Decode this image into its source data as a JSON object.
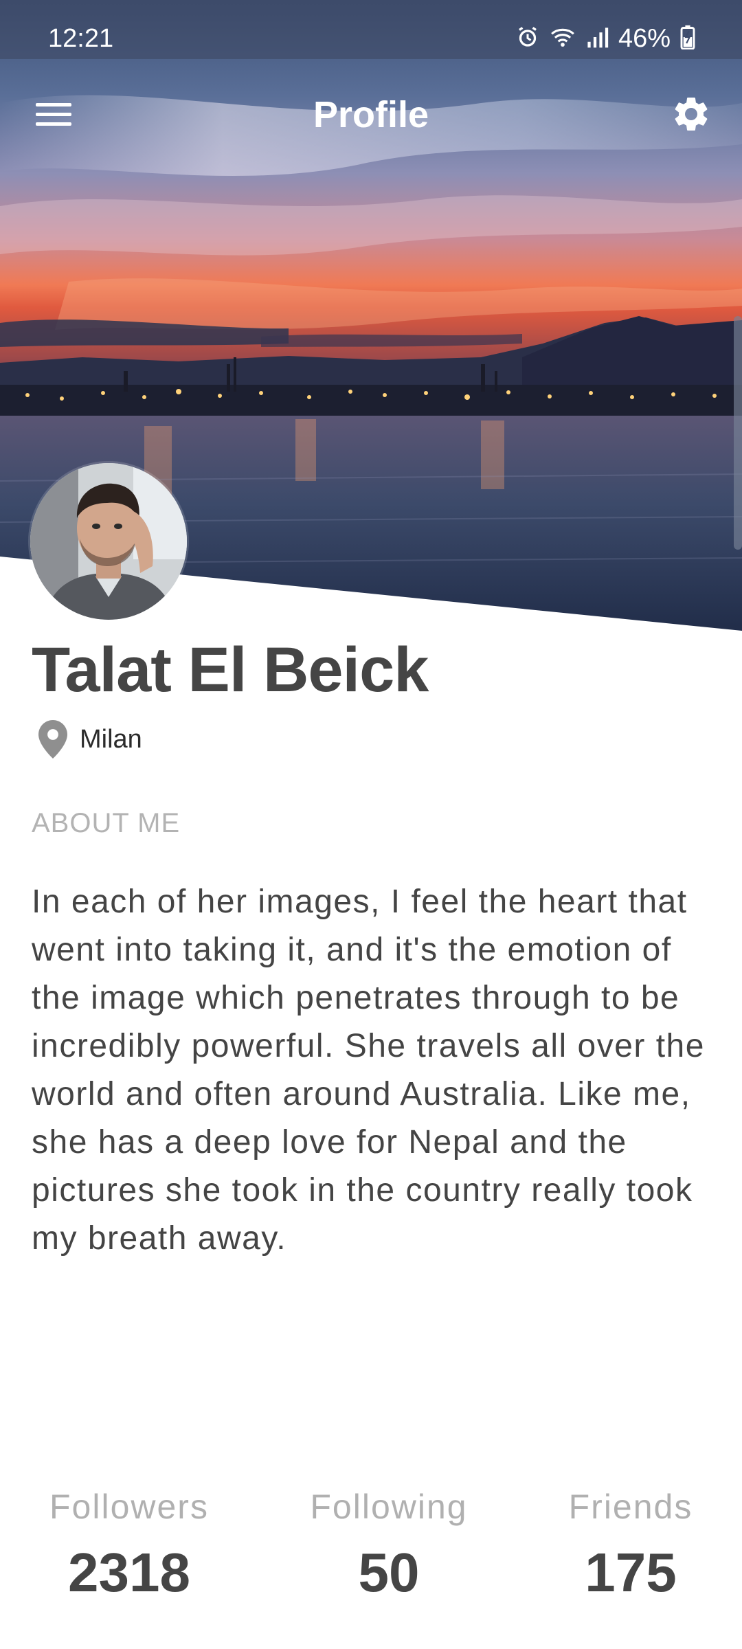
{
  "status_bar": {
    "time": "12:21",
    "battery": "46%",
    "icons": [
      "alarm-icon",
      "wifi-icon",
      "signal-icon",
      "battery-icon"
    ]
  },
  "app_bar": {
    "title": "Profile",
    "menu_icon": "hamburger-menu-icon",
    "settings_icon": "gear-icon"
  },
  "profile": {
    "name": "Talat El Beick",
    "location": "Milan",
    "location_icon": "location-pin-icon",
    "about_heading": "ABOUT ME",
    "about_text": "In each of her images, I feel the heart that went into taking it, and it's the emotion of the image which penetrates through to be incredibly powerful. She travels all over the world and often around Australia. Like me, she has a deep love for Nepal and the pictures she took in the country really took my breath away."
  },
  "stats": [
    {
      "label": "Followers",
      "value": "2318"
    },
    {
      "label": "Following",
      "value": "50"
    },
    {
      "label": "Friends",
      "value": "175"
    }
  ],
  "colors": {
    "name": "#454545",
    "muted": "#b0b0b0",
    "body_text": "#444444"
  }
}
